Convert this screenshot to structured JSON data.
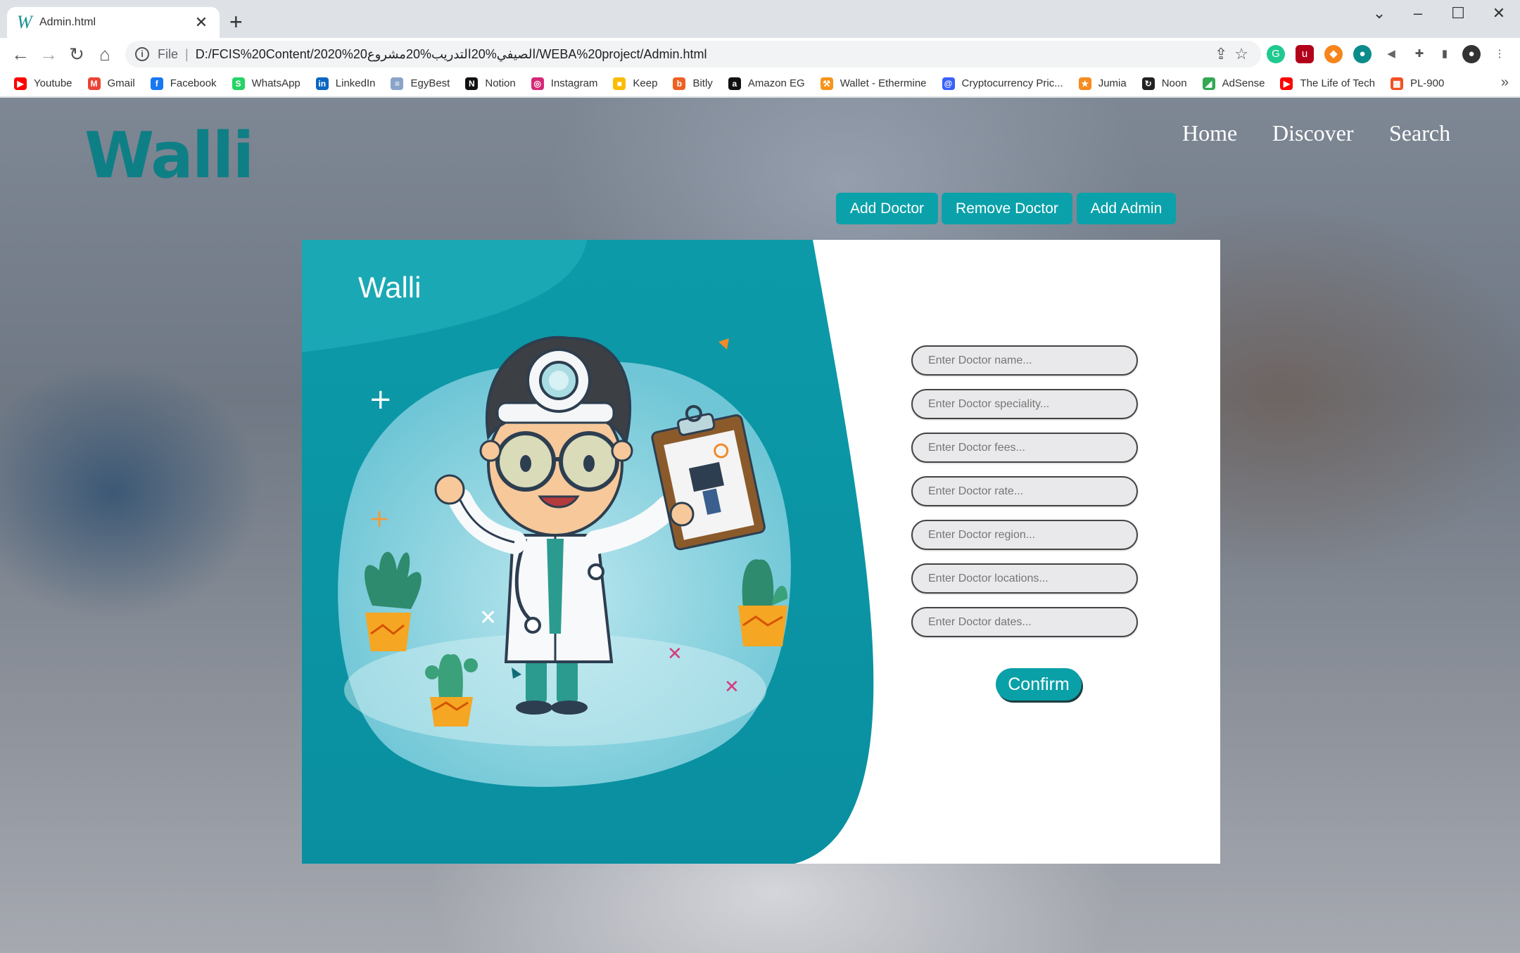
{
  "browser": {
    "tab_title": "Admin.html",
    "tab_favicon": "W",
    "address_scheme": "File",
    "address_url": "D:/FCIS%20Content/2020%20الصيفي%20التدريب%20مشروع/WEBA%20project/Admin.html",
    "bookmarks": [
      {
        "label": "Youtube",
        "icon": "youtube-icon",
        "color": "#ff0000",
        "glyph": "▶"
      },
      {
        "label": "Gmail",
        "icon": "gmail-icon",
        "color": "#ea4335",
        "glyph": "M"
      },
      {
        "label": "Facebook",
        "icon": "facebook-icon",
        "color": "#1877f2",
        "glyph": "f"
      },
      {
        "label": "WhatsApp",
        "icon": "whatsapp-icon",
        "color": "#25d366",
        "glyph": "S"
      },
      {
        "label": "LinkedIn",
        "icon": "linkedin-icon",
        "color": "#0a66c2",
        "glyph": "in"
      },
      {
        "label": "EgyBest",
        "icon": "egybest-icon",
        "color": "#8aa4c8",
        "glyph": "≡"
      },
      {
        "label": "Notion",
        "icon": "notion-icon",
        "color": "#111111",
        "glyph": "N"
      },
      {
        "label": "Instagram",
        "icon": "instagram-icon",
        "color": "#d62976",
        "glyph": "◎"
      },
      {
        "label": "Keep",
        "icon": "keep-icon",
        "color": "#fbbc04",
        "glyph": "■"
      },
      {
        "label": "Bitly",
        "icon": "bitly-icon",
        "color": "#ee6123",
        "glyph": "b"
      },
      {
        "label": "Amazon EG",
        "icon": "amazon-icon",
        "color": "#111111",
        "glyph": "a"
      },
      {
        "label": "Wallet - Ethermine",
        "icon": "ethermine-icon",
        "color": "#f7931a",
        "glyph": "⚒"
      },
      {
        "label": "Cryptocurrency Pric...",
        "icon": "coinmarketcap-icon",
        "color": "#3861fb",
        "glyph": "@"
      },
      {
        "label": "Jumia",
        "icon": "jumia-icon",
        "color": "#f68b1e",
        "glyph": "★"
      },
      {
        "label": "Noon",
        "icon": "noon-icon",
        "color": "#222222",
        "glyph": "↻"
      },
      {
        "label": "AdSense",
        "icon": "adsense-icon",
        "color": "#34a853",
        "glyph": "◢"
      },
      {
        "label": "The Life of Tech",
        "icon": "youtube-icon",
        "color": "#ff0000",
        "glyph": "▶"
      },
      {
        "label": "PL-900",
        "icon": "microsoft-icon",
        "color": "#f25022",
        "glyph": "▦"
      }
    ]
  },
  "site": {
    "logo": "Walli",
    "nav": [
      "Home",
      "Discover",
      "Search"
    ],
    "tabs": [
      "Add Doctor",
      "Remove Doctor",
      "Add Admin"
    ]
  },
  "card": {
    "brand": "Walli",
    "fields": [
      "Enter Doctor name...",
      "Enter Doctor speciality...",
      "Enter Doctor fees...",
      "Enter Doctor rate...",
      "Enter Doctor region...",
      "Enter Doctor locations...",
      "Enter Doctor dates..."
    ],
    "confirm_label": "Confirm"
  },
  "colors": {
    "accent": "#0ba1aa",
    "logo": "#0f7f86",
    "panel": "#0aa0ad"
  }
}
